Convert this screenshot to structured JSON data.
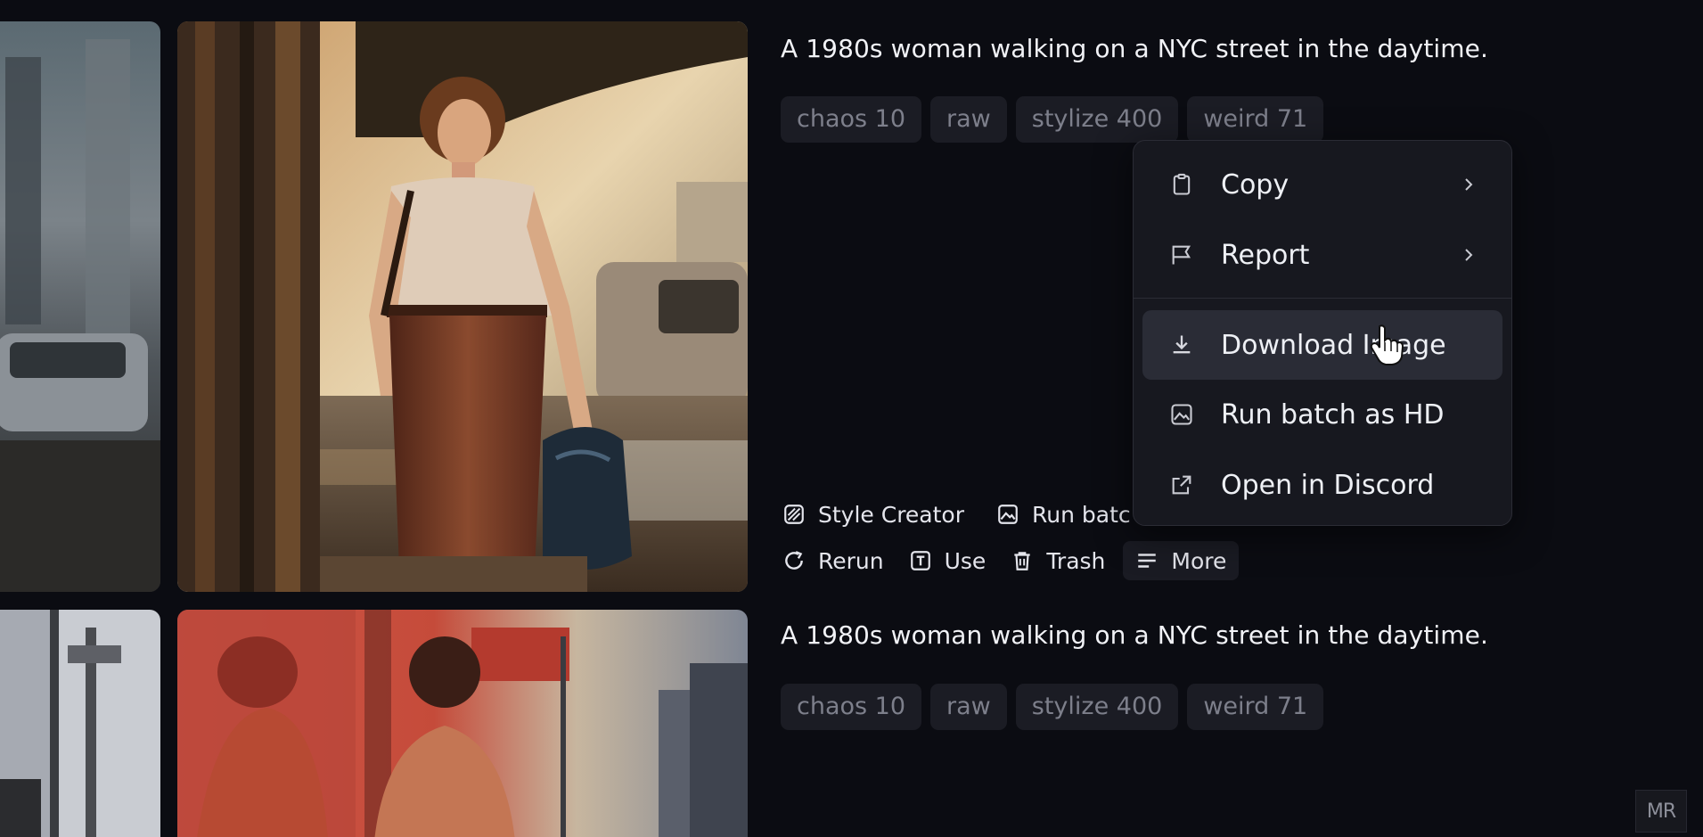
{
  "colors": {
    "background": "#0b0c12",
    "tag_background": "#1b1c24",
    "tag_text": "#7d7f8b",
    "menu_background": "#17181f",
    "menu_hover": "#2a2c36",
    "text_primary": "#eef0f5"
  },
  "prompts": [
    {
      "title": "A 1980s woman walking on a NYC street in the daytime.",
      "tags": [
        "chaos 10",
        "raw",
        "stylize 400",
        "weird 71"
      ]
    },
    {
      "title": "A 1980s woman walking on a NYC street in the daytime.",
      "tags": [
        "chaos 10",
        "raw",
        "stylize 400",
        "weird 71"
      ]
    }
  ],
  "actions": {
    "style_creator": {
      "label": "Style Creator",
      "icon": "style-creator-icon"
    },
    "run_batch": {
      "label": "Run batc",
      "icon": "image-icon"
    },
    "rerun": {
      "label": "Rerun",
      "icon": "rerun-icon"
    },
    "use": {
      "label": "Use",
      "icon": "text-t-icon"
    },
    "trash": {
      "label": "Trash",
      "icon": "trash-icon"
    },
    "more": {
      "label": "More",
      "icon": "menu-lines-icon"
    }
  },
  "context_menu": {
    "items": [
      {
        "label": "Copy",
        "icon": "clipboard-icon",
        "has_submenu": true
      },
      {
        "label": "Report",
        "icon": "flag-icon",
        "has_submenu": true
      },
      {
        "label": "Download Image",
        "icon": "download-icon",
        "has_submenu": false,
        "hovered": true
      },
      {
        "label": "Run batch as HD",
        "icon": "image-icon",
        "has_submenu": false
      },
      {
        "label": "Open in Discord",
        "icon": "external-link-icon",
        "has_submenu": false
      }
    ]
  },
  "watermark": "MR"
}
